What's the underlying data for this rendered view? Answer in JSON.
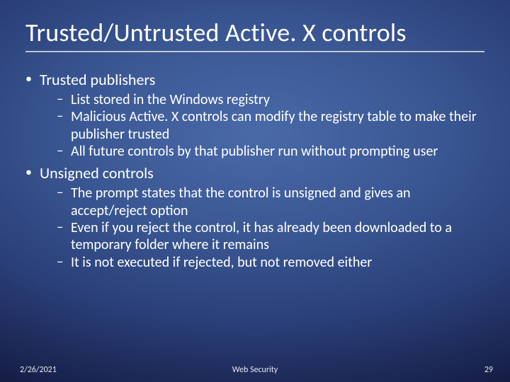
{
  "slide": {
    "title": "Trusted/Untrusted Active. X controls",
    "bullets": [
      {
        "label": "Trusted publishers",
        "sub": [
          "List stored in the Windows registry",
          "Malicious Active. X controls can modify the registry table to make their publisher trusted",
          "All future controls by that publisher run without prompting user"
        ]
      },
      {
        "label": "Unsigned controls",
        "sub": [
          "The prompt states that the control is unsigned and gives an accept/reject option",
          "Even if you reject the control, it has already been downloaded to a temporary folder where it remains",
          "It is not executed if rejected, but not removed either"
        ]
      }
    ]
  },
  "footer": {
    "date": "2/26/2021",
    "center": "Web Security",
    "page": "29"
  },
  "glyphs": {
    "bullet1": "•",
    "bullet2": "–"
  }
}
